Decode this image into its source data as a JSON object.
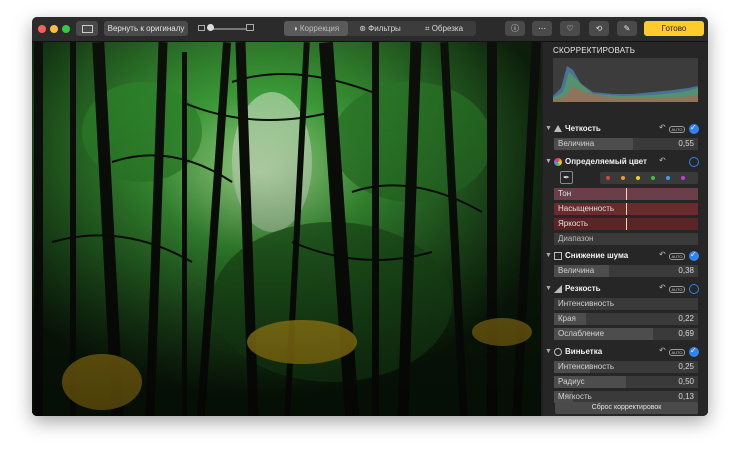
{
  "toolbar": {
    "revert_label": "Вернуть к оригиналу",
    "tabs": [
      {
        "label": "Коррекция",
        "active": true
      },
      {
        "label": "Фильтры",
        "active": false
      },
      {
        "label": "Обрезка",
        "active": false
      }
    ],
    "done_label": "Готово",
    "icons": [
      "info-icon",
      "more-icon",
      "favorite-heart-icon",
      "rotate-icon",
      "magic-wand-icon"
    ]
  },
  "panel": {
    "title": "СКОРРЕКТИРОВАТЬ",
    "sharpness": {
      "title": "Четкость",
      "enabled": true,
      "rows": [
        {
          "label": "Величина",
          "value": "0,55",
          "level": 0.55
        }
      ]
    },
    "selective_color": {
      "title": "Определяемый цвет",
      "enabled": false,
      "swatches": [
        "#e0443c",
        "#f39a2c",
        "#e6d72a",
        "#3fc23f",
        "#3aa0e8",
        "#c13fd6"
      ],
      "rows": [
        {
          "label": "Тон",
          "color": "#6b3f4a"
        },
        {
          "label": "Насыщенность",
          "color": "#6b2a2c"
        },
        {
          "label": "Яркость",
          "color": "#5b2525"
        },
        {
          "label": "Диапазон",
          "color": "#3a3a3a"
        }
      ]
    },
    "noise": {
      "title": "Снижение шума",
      "enabled": true,
      "rows": [
        {
          "label": "Величина",
          "value": "0,38",
          "level": 0.38
        }
      ]
    },
    "sharpen": {
      "title": "Резкость",
      "enabled": false,
      "rows": [
        {
          "label": "Интенсивность",
          "value": "",
          "level": 0
        },
        {
          "label": "Края",
          "value": "0,22",
          "level": 0.22
        },
        {
          "label": "Ослабление",
          "value": "0,69",
          "level": 0.69
        }
      ]
    },
    "vignette": {
      "title": "Виньетка",
      "enabled": true,
      "rows": [
        {
          "label": "Интенсивность",
          "value": "0,25",
          "level": 0.25
        },
        {
          "label": "Радиус",
          "value": "0,50",
          "level": 0.5
        },
        {
          "label": "Мягкость",
          "value": "0,13",
          "level": 0.13
        }
      ]
    },
    "reset_label": "Сброс корректировок"
  }
}
